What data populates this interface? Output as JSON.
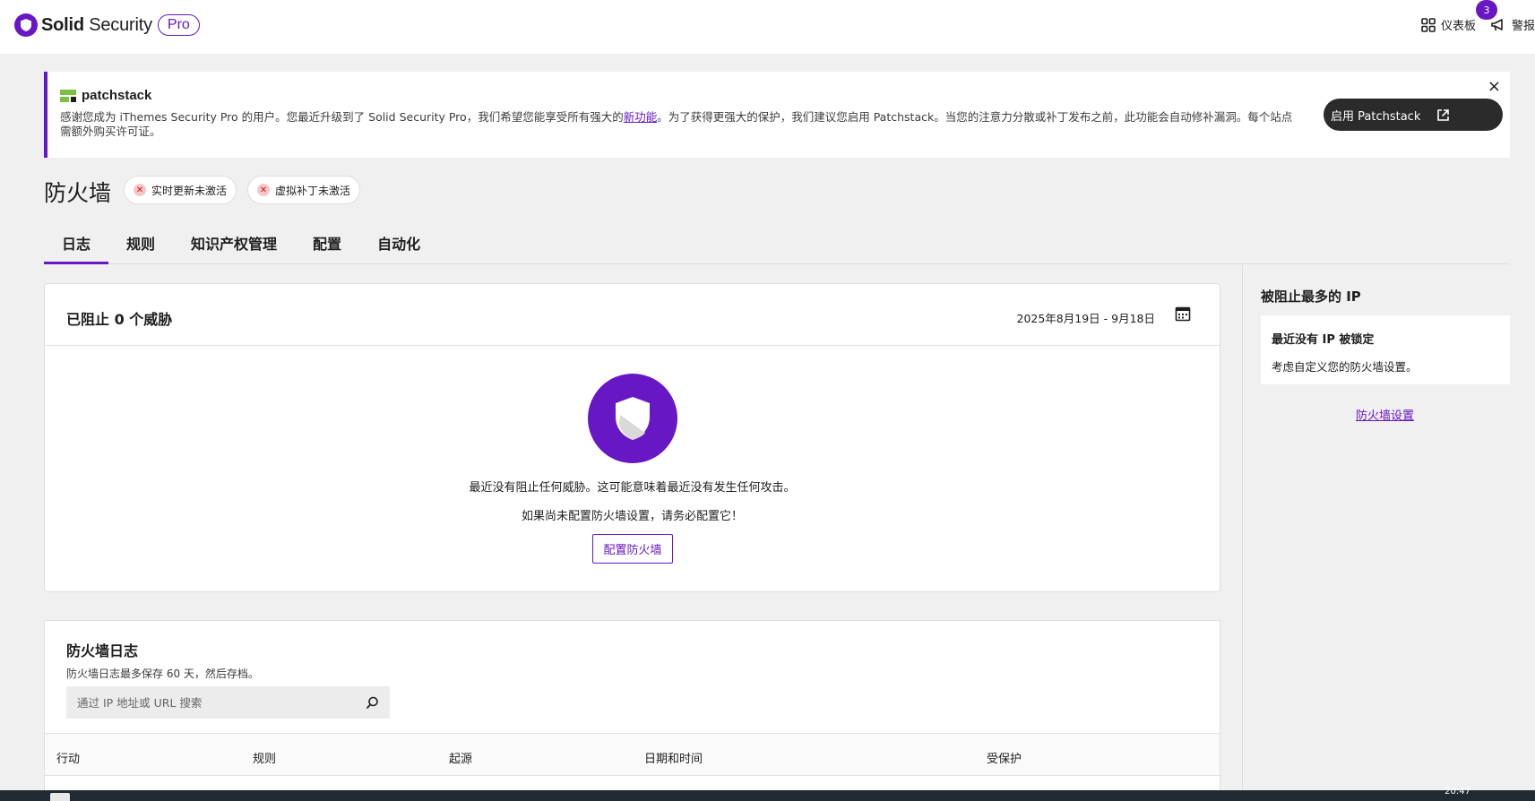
{
  "brand": {
    "name_bold": "Solid",
    "name_rest": " Security",
    "tier": "Pro"
  },
  "header": {
    "dashboard_label": "仪表板",
    "alerts_label": "警报",
    "alerts_count": "3"
  },
  "notice": {
    "brand": "patchstack",
    "text_before_link": "感谢您成为 iThemes Security Pro 的用户。您最近升级到了 Solid Security Pro，我们希望您能享受所有强大的",
    "link_label": "新功能",
    "text_after_link": "。为了获得更强大的保护，我们建议您启用 Patchstack。当您的注意力分散或补丁发布之前，此功能会自动修补漏洞。每个站点需额外购买许可证。",
    "button_label": "启用 Patchstack",
    "close_label": "×"
  },
  "page": {
    "title": "防火墙",
    "pills": [
      "实时更新未激活",
      "虚拟补丁未激活"
    ]
  },
  "tabs": [
    {
      "label": "日志",
      "active": true
    },
    {
      "label": "规则",
      "active": false
    },
    {
      "label": "知识产权管理",
      "active": false
    },
    {
      "label": "配置",
      "active": false
    },
    {
      "label": "自动化",
      "active": false
    }
  ],
  "blocked_card": {
    "title": "已阻止 0 个威胁",
    "date_range": "2025年8月19日 - 9月18日",
    "message_1": "最近没有阻止任何威胁。这可能意味着最近没有发生任何攻击。",
    "message_2": "如果尚未配置防火墙设置，请务必配置它！",
    "button_label": "配置防火墙"
  },
  "log_card": {
    "title": "防火墙日志",
    "description": "防火墙日志最多保存 60 天，然后存档。",
    "search_placeholder": "通过 IP 地址或 URL 搜索",
    "columns": [
      "行动",
      "规则",
      "起源",
      "日期和时间",
      "受保护"
    ]
  },
  "sidebar": {
    "title": "被阻止最多的 IP",
    "box_heading": "最近没有 IP 被锁定",
    "box_text": "考虑自定义您的防火墙设置。",
    "link_label": "防火墙设置"
  },
  "taskbar": {
    "time": "20:47"
  },
  "colors": {
    "accent": "#6817c5",
    "patchstack_green": "#7ac142",
    "dark_button": "#2b2b2b",
    "error_red": "#cc1818"
  }
}
